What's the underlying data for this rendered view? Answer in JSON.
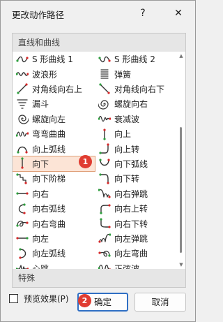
{
  "dialog": {
    "title": "更改动作路径",
    "help_label": "?",
    "close_label": "✕"
  },
  "sections": {
    "lines_and_curves": "直线和曲线",
    "special": "特殊"
  },
  "paths": [
    {
      "label": "S 形曲线 1",
      "icon": "s-curve-1-icon"
    },
    {
      "label": "S 形曲线 2",
      "icon": "s-curve-2-icon"
    },
    {
      "label": "波浪形",
      "icon": "wave-icon"
    },
    {
      "label": "弹簧",
      "icon": "spring-icon"
    },
    {
      "label": "对角线向右上",
      "icon": "diagonal-up-right-icon"
    },
    {
      "label": "对角线向右下",
      "icon": "diagonal-down-right-icon"
    },
    {
      "label": "漏斗",
      "icon": "funnel-icon"
    },
    {
      "label": "螺旋向右",
      "icon": "spiral-right-icon"
    },
    {
      "label": "螺旋向左",
      "icon": "spiral-left-icon"
    },
    {
      "label": "衰减波",
      "icon": "decaying-wave-icon"
    },
    {
      "label": "弯弯曲曲",
      "icon": "zigzag-curvy-icon"
    },
    {
      "label": "向上",
      "icon": "up-icon"
    },
    {
      "label": "向上弧线",
      "icon": "arc-up-icon"
    },
    {
      "label": "向上转",
      "icon": "turn-up-icon"
    },
    {
      "label": "向下",
      "icon": "down-icon"
    },
    {
      "label": "向下弧线",
      "icon": "arc-down-icon"
    },
    {
      "label": "向下阶梯",
      "icon": "stairs-down-icon"
    },
    {
      "label": "向下转",
      "icon": "turn-down-icon"
    },
    {
      "label": "向右",
      "icon": "right-icon"
    },
    {
      "label": "向右弹跳",
      "icon": "bounce-right-icon"
    },
    {
      "label": "向右弧线",
      "icon": "arc-right-icon"
    },
    {
      "label": "向右上转",
      "icon": "turn-up-right-icon"
    },
    {
      "label": "向右弯曲",
      "icon": "curvy-right-icon"
    },
    {
      "label": "向右下转",
      "icon": "turn-down-right-icon"
    },
    {
      "label": "向左",
      "icon": "left-icon"
    },
    {
      "label": "向左弹跳",
      "icon": "bounce-left-icon"
    },
    {
      "label": "向左弧线",
      "icon": "arc-left-icon"
    },
    {
      "label": "向左弯曲",
      "icon": "curvy-left-icon"
    },
    {
      "label": "心跳",
      "icon": "heartbeat-icon"
    },
    {
      "label": "正弦波",
      "icon": "sine-wave-icon"
    }
  ],
  "selected_path": "向下",
  "badges": {
    "first": "1",
    "second": "2"
  },
  "footer": {
    "preview_label": "预览效果(P)",
    "preview_checked": false,
    "ok_label": "确定",
    "cancel_label": "取消"
  },
  "colors": {
    "path_start": "#2e9e3e",
    "path_end": "#d62728",
    "selection_bg": "#fce4d6",
    "badge": "#e03c31",
    "default_button_border": "#2f6fc4"
  }
}
